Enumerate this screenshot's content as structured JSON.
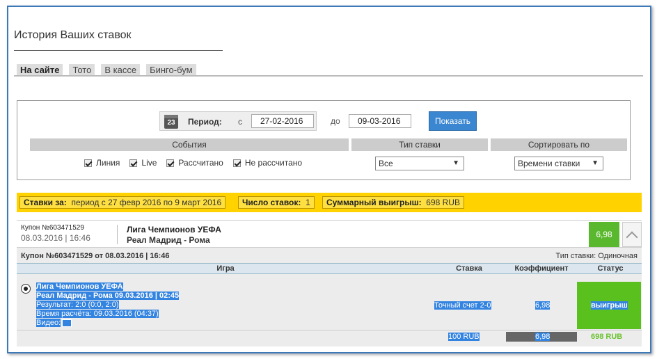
{
  "page": {
    "title": "История Ваших ставок"
  },
  "tabs": [
    {
      "label": "На сайте",
      "active": true
    },
    {
      "label": "Тото",
      "active": false
    },
    {
      "label": "В кассе",
      "active": false
    },
    {
      "label": "Бинго-бум",
      "active": false
    }
  ],
  "filter": {
    "calendar_day": "23",
    "period_label": "Период:",
    "from_label": "с",
    "from_value": "27-02-2016",
    "to_label": "до",
    "to_value": "09-03-2016",
    "show_button": "Показать",
    "events_header": "События",
    "bet_type_header": "Тип ставки",
    "sort_header": "Сортировать по",
    "checkboxes": [
      {
        "label": "Линия",
        "checked": true
      },
      {
        "label": "Live",
        "checked": true
      },
      {
        "label": "Рассчитано",
        "checked": true
      },
      {
        "label": "Не рассчитано",
        "checked": true
      }
    ],
    "bet_type_value": "Все",
    "sort_value": "Времени ставки"
  },
  "summary": {
    "period_label": "Ставки за:",
    "period_value": "период с 27 февр 2016 по 9 март 2016",
    "count_label": "Число ставок:",
    "count_value": "1",
    "total_label": "Суммарный выигрыш:",
    "total_value": "698 RUB"
  },
  "coupon": {
    "number": "Купон №603471529",
    "datetime": "08.03.2016 | 16:46",
    "league": "Лига Чемпионов УЕФА",
    "match": "Реал Мадрид - Рома",
    "coef": "6,98"
  },
  "detail": {
    "title": "Купон №603471529 от 08.03.2016 | 16:46",
    "bet_type": "Тип ставки: Одиночная",
    "columns": [
      "Игра",
      "Ставка",
      "Коэффициент",
      "Статус"
    ],
    "game_league": "Лига Чемпионов УЕФА",
    "game_match": "Реал Мадрид - Рома 09.03.2016 | 02:45",
    "result": "Результат: 2:0 (0:0, 2:0)",
    "calc_time": "Время расчёта: 09.03.2016 (04:37)",
    "video_label": "Видео:",
    "stake": "Точный счет 2-0",
    "coef": "6,98",
    "status": "выигрыш",
    "total_stake": "100 RUB",
    "total_coef": "6,98",
    "total_win": "698 RUB"
  },
  "colors": {
    "accent": "#3a86d0",
    "summary_bar": "#ffd200",
    "win": "#5ac01e",
    "selection": "#3383e0"
  }
}
